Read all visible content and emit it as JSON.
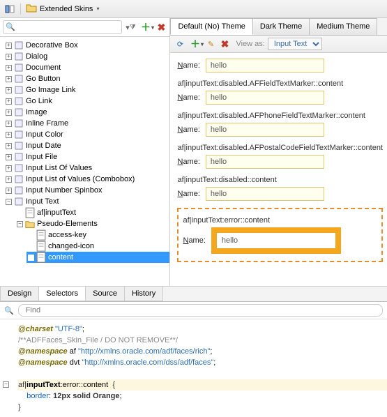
{
  "topbar": {
    "folder_label": "Extended Skins"
  },
  "tree_search": {
    "placeholder": ""
  },
  "tree": {
    "items": [
      {
        "label": "Decorative Box",
        "exp": "+"
      },
      {
        "label": "Dialog",
        "exp": "+"
      },
      {
        "label": "Document",
        "exp": "+"
      },
      {
        "label": "Go Button",
        "exp": "+"
      },
      {
        "label": "Go Image Link",
        "exp": "+"
      },
      {
        "label": "Go Link",
        "exp": "+"
      },
      {
        "label": "Image",
        "exp": "+"
      },
      {
        "label": "Inline Frame",
        "exp": "+"
      },
      {
        "label": "Input Color",
        "exp": "+"
      },
      {
        "label": "Input Date",
        "exp": "+"
      },
      {
        "label": "Input File",
        "exp": "+"
      },
      {
        "label": "Input List Of Values",
        "exp": "+"
      },
      {
        "label": "Input List of Values (Combobox)",
        "exp": "+"
      },
      {
        "label": "Input Number Spinbox",
        "exp": "+"
      },
      {
        "label": "Input Text",
        "exp": "-",
        "children": [
          {
            "label": "af|inputText",
            "leaf": true
          },
          {
            "label": "Pseudo-Elements",
            "exp": "-",
            "folder": true,
            "children": [
              {
                "label": "access-key",
                "leaf": true
              },
              {
                "label": "changed-icon",
                "leaf": true
              },
              {
                "label": "content",
                "leaf": true,
                "selected": true
              }
            ]
          }
        ]
      }
    ]
  },
  "themeTabs": [
    {
      "label": "Default (No) Theme",
      "active": true
    },
    {
      "label": "Dark Theme"
    },
    {
      "label": "Medium Theme"
    }
  ],
  "previewToolbar": {
    "view_as_label": "View as:",
    "view_as_value": "Input Text"
  },
  "preview": {
    "name_label_pre": "N",
    "name_label_post": "ame:",
    "sections": [
      {
        "selector": "",
        "value": "hello"
      },
      {
        "selector": "af|inputText:disabled.AFFieldTextMarker::content",
        "value": "hello"
      },
      {
        "selector": "af|inputText:disabled.AFPhoneFieldTextMarker::content",
        "value": "hello"
      },
      {
        "selector": "af|inputText:disabled.AFPostalCodeFieldTextMarker::content",
        "value": "hello"
      },
      {
        "selector": "af|inputText:disabled::content",
        "value": "hello"
      }
    ],
    "errorSection": {
      "selector": "af|inputText:error::content",
      "value": "hello"
    }
  },
  "bottomTabs": [
    {
      "label": "Design"
    },
    {
      "label": "Selectors",
      "active": true
    },
    {
      "label": "Source"
    },
    {
      "label": "History"
    }
  ],
  "find": {
    "placeholder": "Find"
  },
  "code": {
    "charset": "@charset",
    "charset_val": "\"UTF-8\"",
    "comment": "/**ADFFaces_Skin_File / DO NOT REMOVE**/",
    "ns_kw": "@namespace",
    "ns1_pfx": "af",
    "ns1_url": "\"http://xmlns.oracle.com/adf/faces/rich\"",
    "ns2_pfx": "dvt",
    "ns2_url": "\"http://xmlns.oracle.com/dss/adf/faces\"",
    "rule_sel_1": "af|",
    "rule_sel_2": "inputText",
    "rule_sel_3": ":error",
    "rule_sel_4": "::",
    "rule_sel_5": "content",
    "prop": "border",
    "val": "12px solid Orange"
  }
}
